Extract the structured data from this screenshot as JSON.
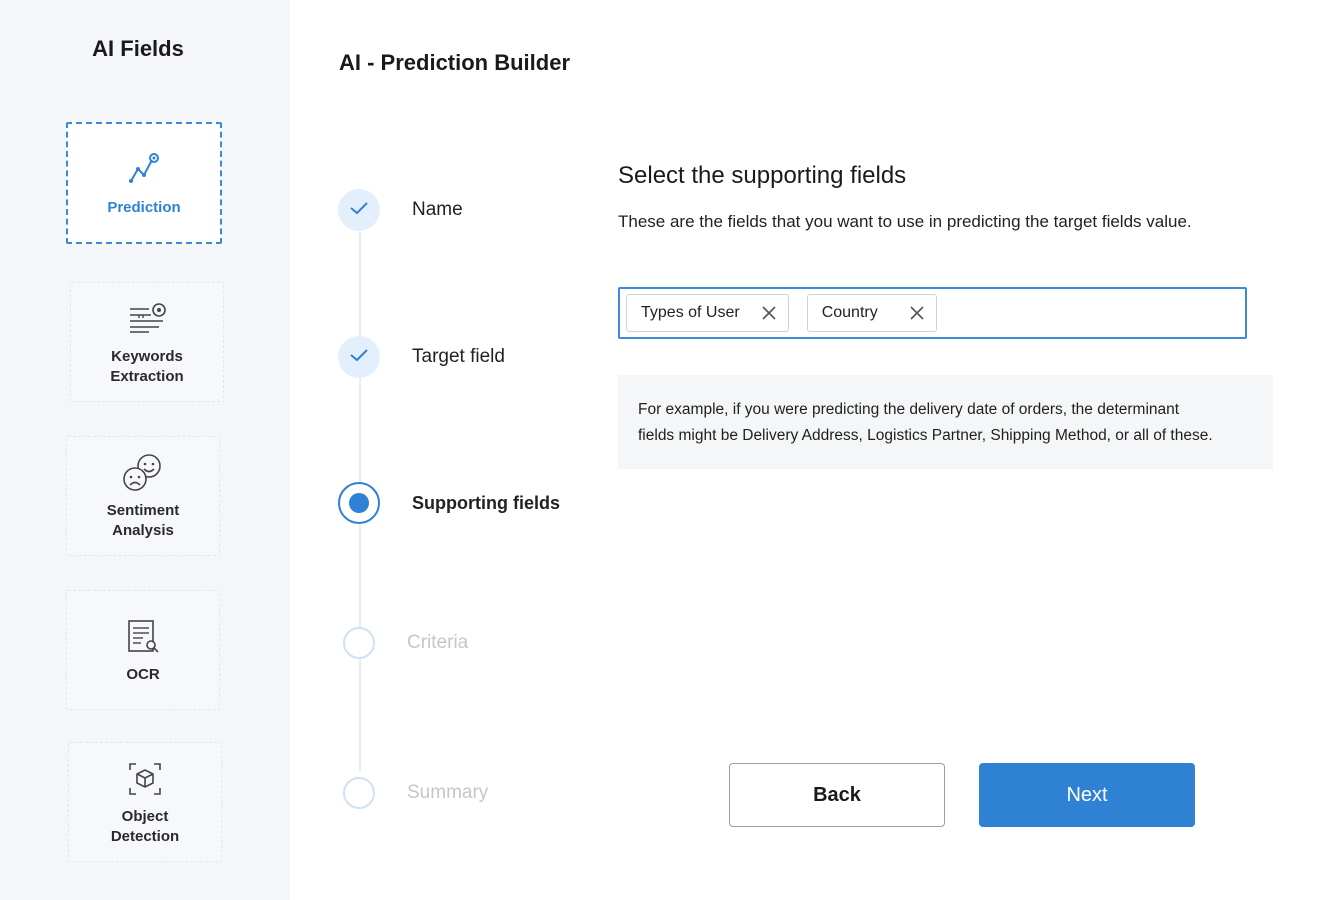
{
  "sidebar": {
    "title": "AI Fields",
    "items": [
      {
        "label_line1": "Prediction",
        "label_line2": "",
        "icon": "prediction-icon"
      },
      {
        "label_line1": "Keywords",
        "label_line2": "Extraction",
        "icon": "keywords-icon"
      },
      {
        "label_line1": "Sentiment",
        "label_line2": "Analysis",
        "icon": "sentiment-icon"
      },
      {
        "label_line1": "OCR",
        "label_line2": "",
        "icon": "ocr-icon"
      },
      {
        "label_line1": "Object",
        "label_line2": "Detection",
        "icon": "object-detection-icon"
      }
    ]
  },
  "header": {
    "title": "AI - Prediction Builder"
  },
  "stepper": {
    "steps": [
      {
        "label": "Name",
        "state": "done"
      },
      {
        "label": "Target field",
        "state": "done"
      },
      {
        "label": "Supporting fields",
        "state": "current"
      },
      {
        "label": "Criteria",
        "state": "pending"
      },
      {
        "label": "Summary",
        "state": "pending"
      }
    ]
  },
  "main": {
    "heading": "Select the supporting fields",
    "subheading": "These are the fields that you want to use in predicting the target fields value.",
    "selected_fields": [
      "Types of User",
      "Country"
    ],
    "example_line1": "For example, if you were predicting the delivery date of orders, the determinant",
    "example_line2": "fields might be Delivery Address, Logistics Partner, Shipping Method, or all of these."
  },
  "actions": {
    "back_label": "Back",
    "next_label": "Next"
  },
  "colors": {
    "accent": "#2f82d3",
    "sidebar_bg": "#f4f6fa"
  }
}
